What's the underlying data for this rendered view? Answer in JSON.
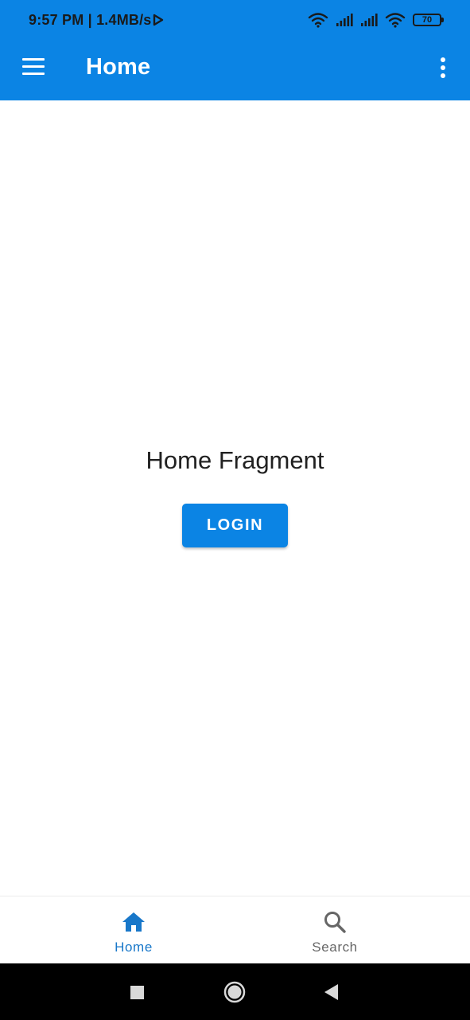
{
  "status_bar": {
    "time": "9:57 PM | 1.4MB/s",
    "battery": "70",
    "icons": [
      "play-outline-icon",
      "wifi-icon",
      "signal-icon",
      "signal-icon",
      "wifi-icon"
    ]
  },
  "app_bar": {
    "title": "Home",
    "menu_icon": "hamburger-menu-icon",
    "overflow_icon": "more-vert-icon"
  },
  "content": {
    "fragment_title": "Home Fragment",
    "login_button": "LOGIN"
  },
  "bottom_nav": {
    "items": [
      {
        "label": "Home",
        "icon": "home-icon",
        "selected": true
      },
      {
        "label": "Search",
        "icon": "search-icon",
        "selected": false
      }
    ]
  },
  "system_nav": {
    "buttons": [
      "recents-square-icon",
      "home-circle-icon",
      "back-triangle-icon"
    ]
  },
  "colors": {
    "primary": "#0B84E4",
    "nav_selected": "#1877C9",
    "nav_unselected": "#666666"
  }
}
